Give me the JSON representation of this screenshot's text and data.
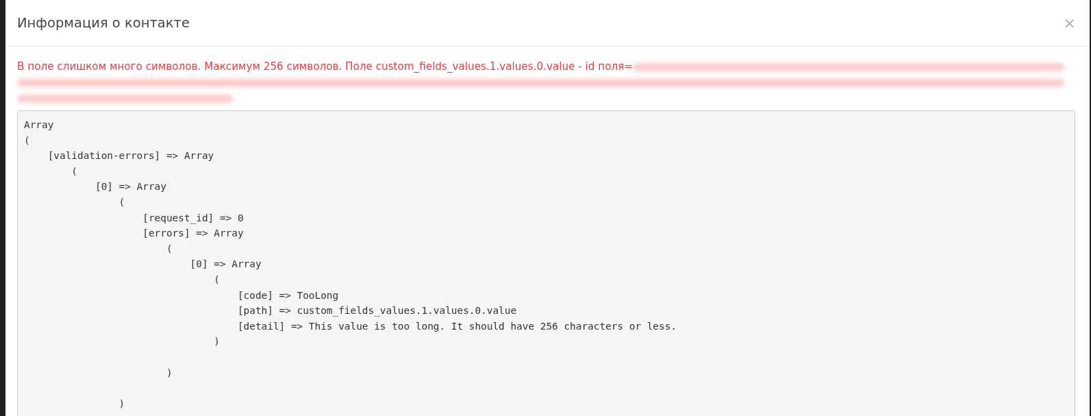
{
  "dialog": {
    "title": "Информация о контакте",
    "close": "×"
  },
  "error_message": {
    "text": "В поле слишком много символов. Максимум 256 символов. Поле custom_fields_values.1.values.0.value - id поля=",
    "redacted": true
  },
  "code_block": {
    "text": "Array\n(\n    [validation-errors] => Array\n        (\n            [0] => Array\n                (\n                    [request_id] => 0\n                    [errors] => Array\n                        (\n                            [0] => Array\n                                (\n                                    [code] => TooLong\n                                    [path] => custom_fields_values.1.values.0.value\n                                    [detail] => This value is too long. It should have 256 characters or less.\n                                )\n\n                        )\n\n                )"
  }
}
